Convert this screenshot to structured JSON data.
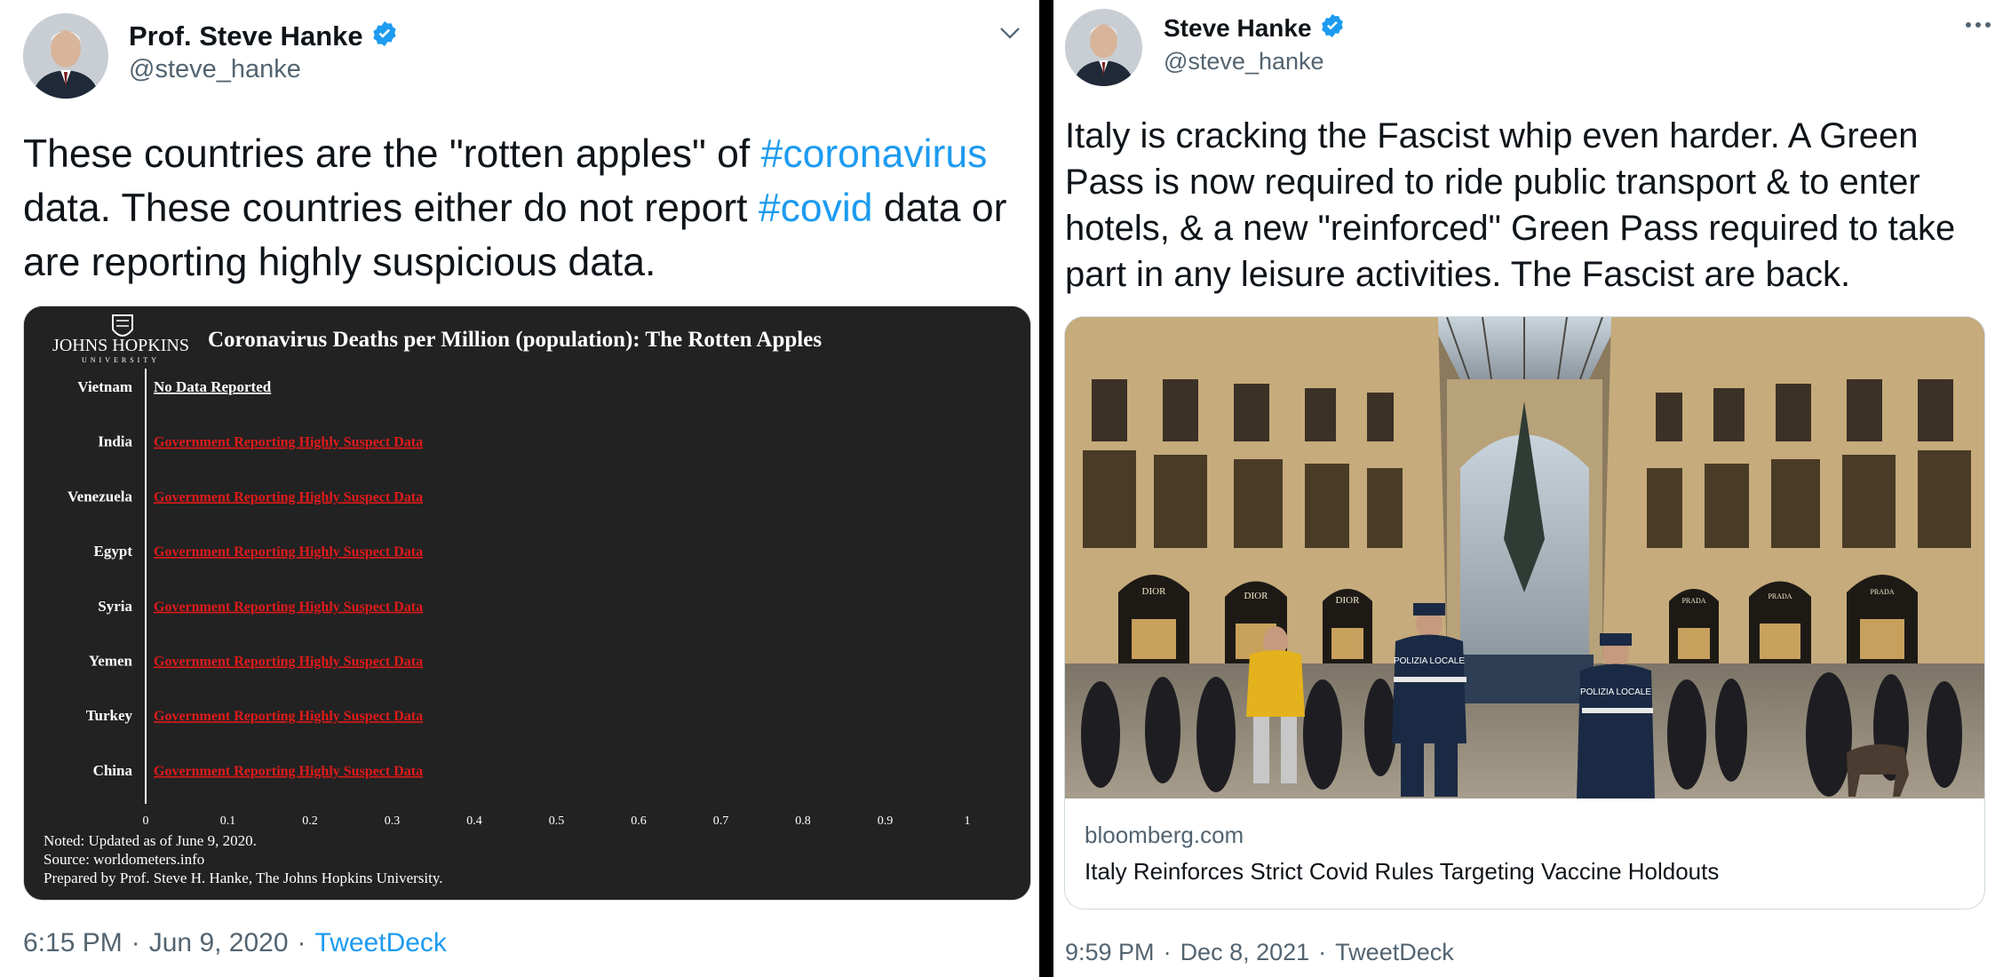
{
  "left_tweet": {
    "display_name": "Prof. Steve Hanke",
    "handle": "@steve_hanke",
    "text_part1": "These countries are the \"rotten apples\" of ",
    "hashtag1": "#coronavirus",
    "text_part2": " data. These countries either do not report ",
    "hashtag2": "#covid",
    "text_part3": " data or are reporting highly suspicious data.",
    "time": "6:15 PM",
    "date": "Jun 9, 2020",
    "separator": "·",
    "source": "TweetDeck",
    "menu_icon": "chevron-down-icon"
  },
  "chart_data": {
    "type": "bar",
    "logo_text": "JOHNS HOPKINS",
    "logo_subtext": "UNIVERSITY",
    "title": "Coronavirus Deaths per Million (population):  The Rotten Apples",
    "categories": [
      "Vietnam",
      "India",
      "Venezuela",
      "Egypt",
      "Syria",
      "Yemen",
      "Turkey",
      "China"
    ],
    "bar_labels": [
      "No Data Reported",
      "Government Reporting Highly Suspect Data",
      "Government Reporting Highly Suspect Data",
      "Government Reporting Highly Suspect Data",
      "Government Reporting Highly Suspect Data",
      "Government Reporting Highly Suspect Data",
      "Government Reporting Highly Suspect Data",
      "Government Reporting Highly Suspect Data"
    ],
    "x_ticks": [
      "0",
      "0.1",
      "0.2",
      "0.3",
      "0.4",
      "0.5",
      "0.6",
      "0.7",
      "0.8",
      "0.9",
      "1"
    ],
    "xlim": [
      0,
      1
    ],
    "notes": [
      "Noted: Updated as of June 9, 2020.",
      "Source: worldometers.info",
      "Prepared by Prof. Steve H. Hanke, The Johns Hopkins University."
    ],
    "colors": {
      "background": "#222222",
      "text": "#ffffff",
      "suspect_label": "#e01a1a"
    }
  },
  "right_tweet": {
    "display_name": "Steve Hanke",
    "handle": "@steve_hanke",
    "text": "Italy is cracking the Fascist whip even harder. A Green Pass is now required to ride public transport & to enter hotels, & a new \"reinforced\" Green Pass required to take part in any leisure activities. The Fascist are back.",
    "link_domain": "bloomberg.com",
    "link_title": "Italy Reinforces Strict Covid Rules Targeting Vaccine Holdouts",
    "time": "9:59 PM",
    "date": "Dec 8, 2021",
    "separator": "·",
    "source": "TweetDeck",
    "menu_icon": "more-horizontal-icon",
    "photo_store_signs": [
      "DIOR",
      "DIOR",
      "DIOR",
      "PRADA",
      "PRADA",
      "PRADA"
    ],
    "photo_police_text": [
      "POLIZIA LOCALE",
      "POLIZIA LOCALE"
    ]
  },
  "colors": {
    "accent": "#1d9bf0",
    "text": "#0f1419",
    "secondary_text": "#536471",
    "divider": "#000000"
  }
}
